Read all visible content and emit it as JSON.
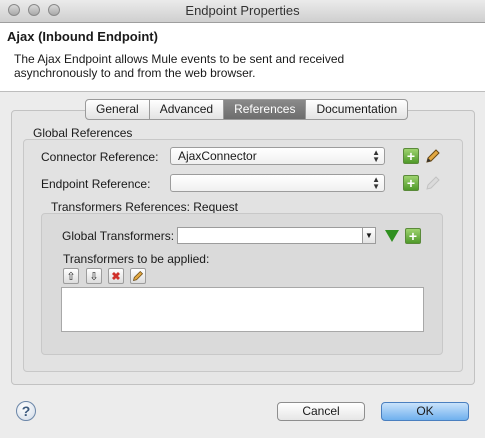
{
  "window": {
    "title": "Endpoint Properties"
  },
  "header": {
    "title": "Ajax (Inbound Endpoint)",
    "description_line1": "The Ajax Endpoint allows Mule events to be sent and received",
    "description_line2": "asynchronously to and from the web browser."
  },
  "tabs": [
    {
      "label": "General"
    },
    {
      "label": "Advanced"
    },
    {
      "label": "References",
      "active": true
    },
    {
      "label": "Documentation"
    }
  ],
  "global_references": {
    "group_label": "Global References",
    "connector_label": "Connector Reference:",
    "connector_value": "AjaxConnector",
    "endpoint_label": "Endpoint Reference:",
    "endpoint_value": ""
  },
  "transformers": {
    "group_label": "Transformers References: Request",
    "global_label": "Global Transformers:",
    "global_value": "",
    "applied_label": "Transformers to be applied:",
    "applied_items": []
  },
  "footer": {
    "cancel_label": "Cancel",
    "ok_label": "OK",
    "help_glyph": "?"
  },
  "icons": {
    "add": "plus-icon",
    "edit": "pencil-icon",
    "move_up": "arrow-up-icon",
    "move_down": "arrow-down-icon",
    "remove": "red-x-icon",
    "apply": "green-triangle-icon"
  },
  "colors": {
    "ok_button": "#6fb0ee",
    "add_icon": "#4f9a2a",
    "remove_icon": "#d0302a"
  }
}
